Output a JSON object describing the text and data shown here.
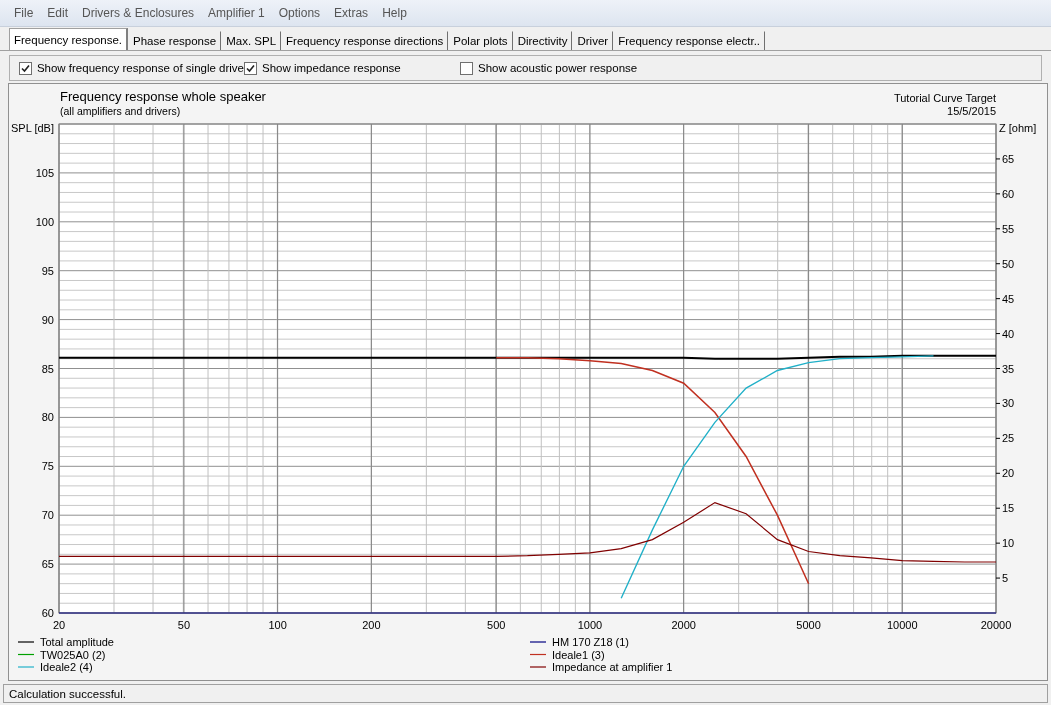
{
  "menu": [
    "File",
    "Edit",
    "Drivers & Enclosures",
    "Amplifier 1",
    "Options",
    "Extras",
    "Help"
  ],
  "tabs": [
    {
      "label": "Frequency response.",
      "selected": true
    },
    {
      "label": "Phase response",
      "selected": false
    },
    {
      "label": "Max. SPL",
      "selected": false
    },
    {
      "label": "Frequency response directions",
      "selected": false
    },
    {
      "label": "Polar plots",
      "selected": false
    },
    {
      "label": "Directivity",
      "selected": false
    },
    {
      "label": "Driver",
      "selected": false
    },
    {
      "label": "Frequency response electr..",
      "selected": false
    }
  ],
  "options": [
    {
      "label": "Show frequency response of single drive",
      "checked": true
    },
    {
      "label": "Show impedance response",
      "checked": true
    },
    {
      "label": "Show acoustic power response",
      "checked": false
    }
  ],
  "chart": {
    "title": "Frequency response whole speaker",
    "subtitle": "(all amplifiers and drivers)",
    "note": "Tutorial Curve Target",
    "date": "15/5/2015",
    "left_axis_label": "SPL [dB]",
    "right_axis_label": "Z [ohm]",
    "chart_data": {
      "type": "line",
      "categories": [
        "20",
        null,
        null,
        null,
        "50",
        null,
        null,
        "100",
        null,
        null,
        "200",
        null,
        null,
        null,
        "500",
        null,
        null,
        "1000",
        null,
        null,
        "2000",
        null,
        null,
        null,
        "5000",
        null,
        null,
        "10000",
        null,
        null,
        "20000"
      ],
      "grid": true,
      "legend": "bottom",
      "ylim": [
        60,
        110
      ],
      "y2lim": [
        0,
        70
      ],
      "yticks": [
        60,
        65,
        70,
        75,
        80,
        85,
        90,
        95,
        100,
        105
      ],
      "y2ticks": [
        5,
        10,
        15,
        20,
        25,
        30,
        35,
        40,
        45,
        50,
        55,
        60,
        65
      ],
      "series": [
        {
          "name": "Total amplitude",
          "color": "#000000",
          "values": [
            86.1,
            86.1,
            86.1,
            86.1,
            86.1,
            86.1,
            86.1,
            86.1,
            86.1,
            86.1,
            86.1,
            86.1,
            86.1,
            86.1,
            86.1,
            86.1,
            86.1,
            86.1,
            86.1,
            86.1,
            86.1,
            86.0,
            86.0,
            86.0,
            86.1,
            86.2,
            86.2,
            86.3,
            86.3,
            86.3,
            86.3
          ]
        },
        {
          "name": "HM 170 Z18 (1)",
          "color": "#000080",
          "values": [
            null,
            null,
            null,
            null,
            null,
            null,
            null,
            null,
            null,
            null,
            null,
            null,
            null,
            null,
            null,
            null,
            null,
            null,
            null,
            null,
            null,
            null,
            null,
            null,
            null,
            null,
            null,
            null,
            null,
            null,
            null
          ]
        },
        {
          "name": "TW025A0 (2)",
          "color": "#00a000",
          "values": [
            null,
            null,
            null,
            null,
            null,
            null,
            null,
            null,
            null,
            null,
            null,
            null,
            null,
            null,
            null,
            null,
            null,
            null,
            null,
            null,
            null,
            null,
            null,
            null,
            null,
            null,
            null,
            null,
            null,
            null,
            null
          ]
        },
        {
          "name": "Ideale1 (3)",
          "color": "#c03020",
          "values": [
            null,
            null,
            null,
            null,
            null,
            null,
            null,
            null,
            null,
            null,
            null,
            null,
            null,
            null,
            86.1,
            86.1,
            86.0,
            85.8,
            85.5,
            84.8,
            83.5,
            80.5,
            76.0,
            70.0,
            63.0,
            null,
            null,
            null,
            null,
            null,
            null
          ]
        },
        {
          "name": "Ideale2 (4)",
          "color": "#20b0c8",
          "values": [
            null,
            null,
            null,
            null,
            null,
            null,
            null,
            null,
            null,
            null,
            null,
            null,
            null,
            null,
            null,
            null,
            null,
            null,
            61.5,
            68.5,
            75.0,
            79.5,
            83.0,
            84.8,
            85.6,
            86.0,
            86.1,
            86.2,
            86.3,
            null,
            null
          ]
        },
        {
          "name": "Impedance at amplifier 1",
          "color": "#800000",
          "axis": "y2",
          "values": [
            8.1,
            8.1,
            8.1,
            8.1,
            8.1,
            8.1,
            8.1,
            8.1,
            8.1,
            8.1,
            8.1,
            8.1,
            8.1,
            8.1,
            8.1,
            8.2,
            8.4,
            8.6,
            9.2,
            10.5,
            13.0,
            15.8,
            14.2,
            10.5,
            8.8,
            8.2,
            7.9,
            7.5,
            7.4,
            7.3,
            7.3
          ]
        }
      ]
    }
  },
  "status": "Calculation successful."
}
